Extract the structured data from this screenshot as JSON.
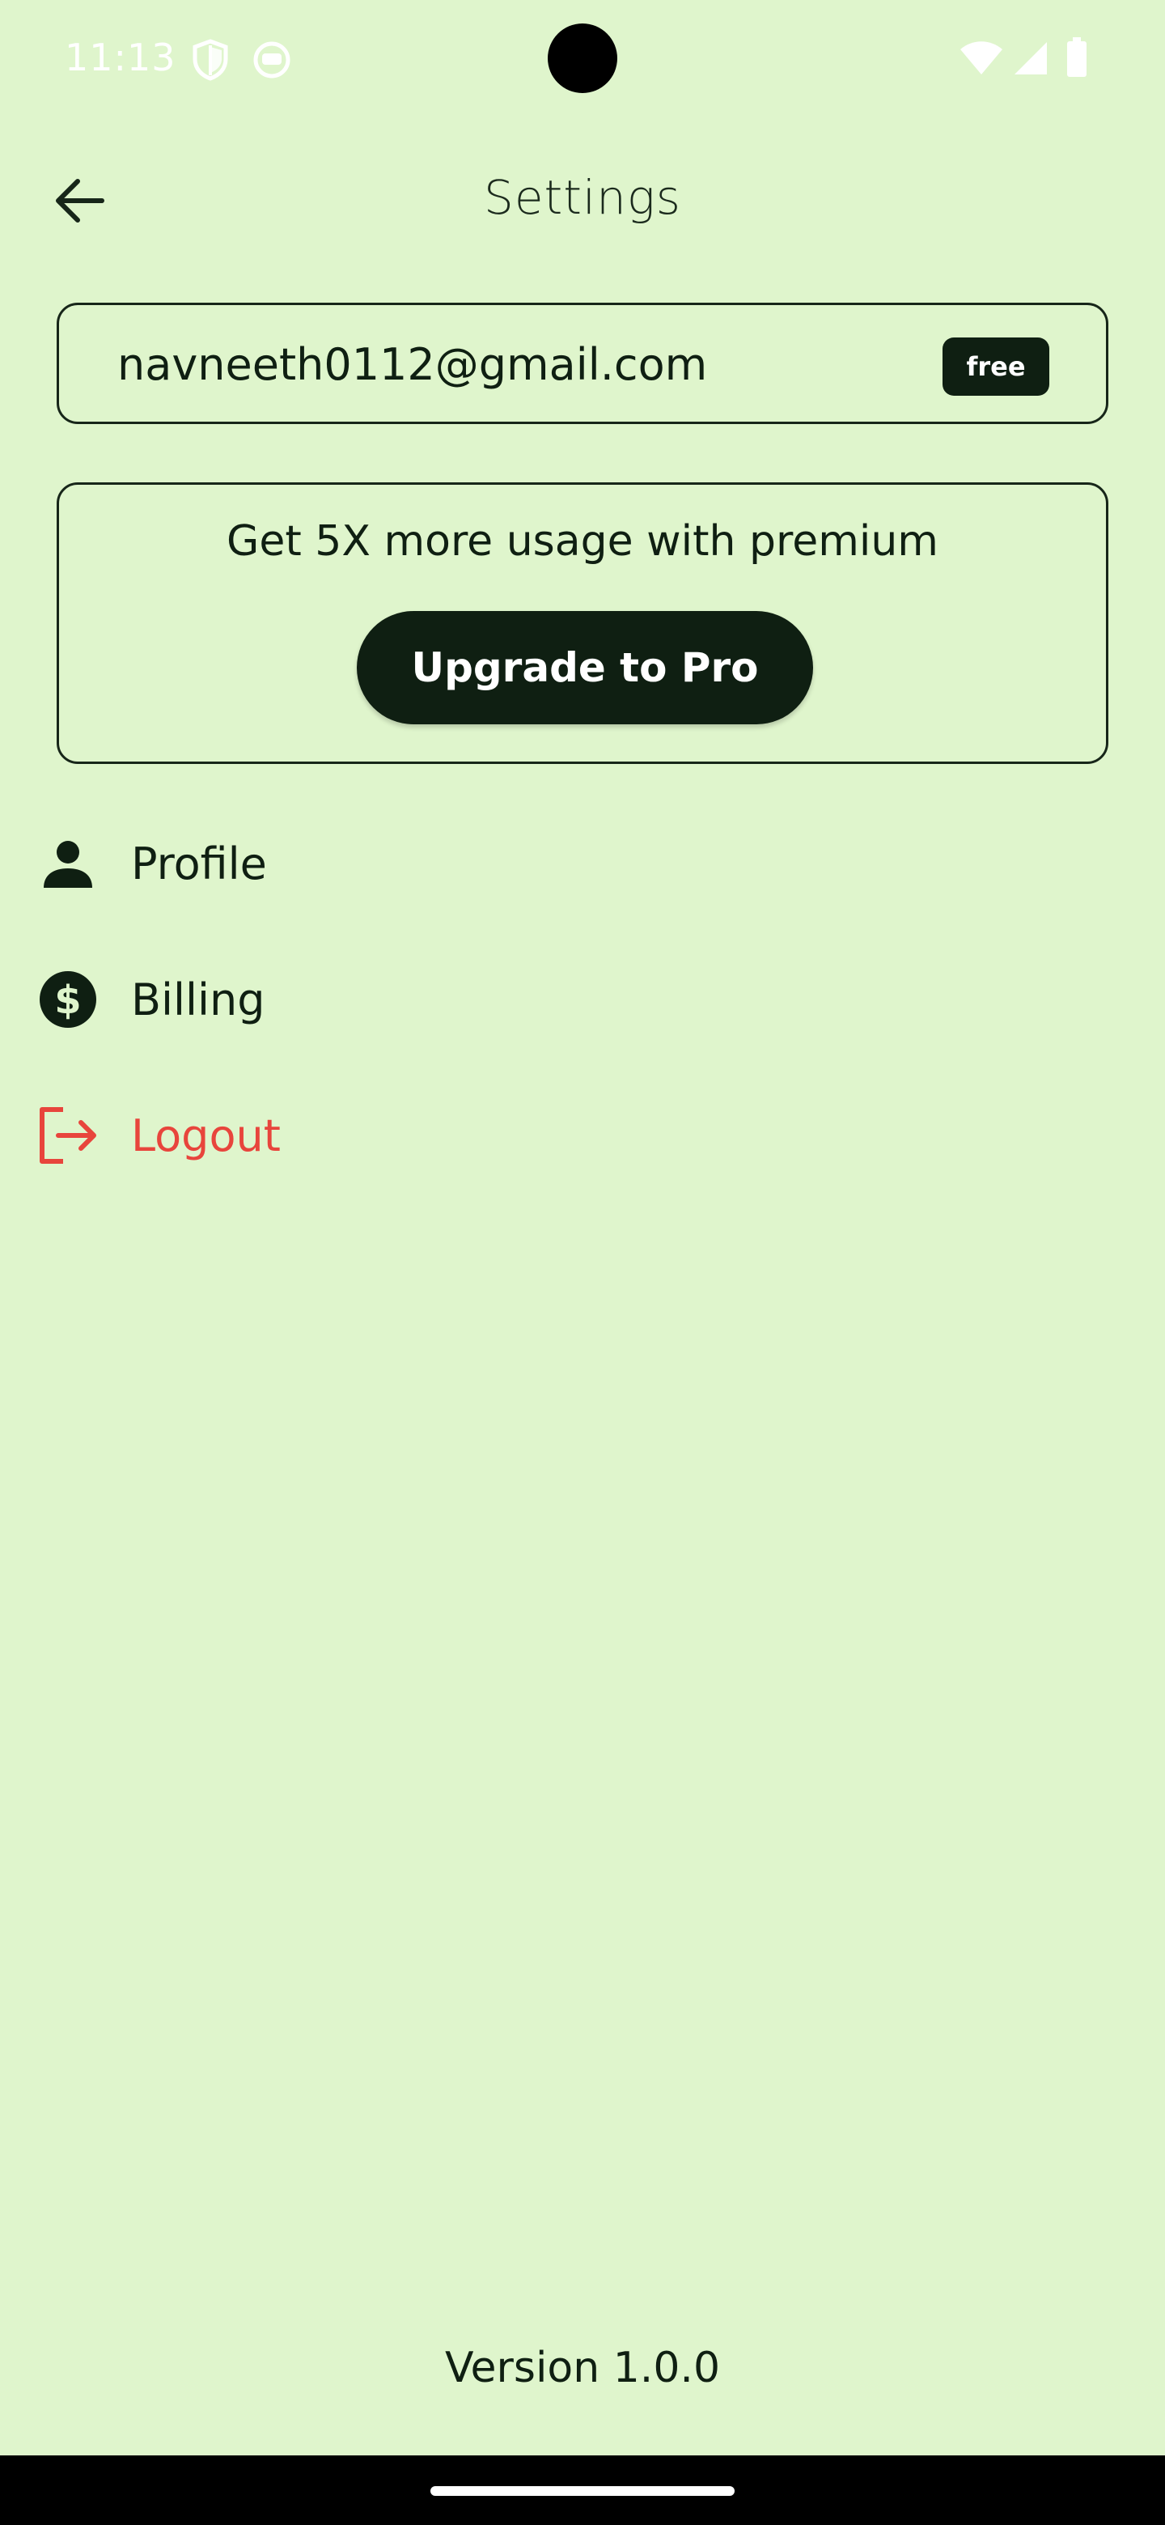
{
  "status_bar": {
    "time": "11:13",
    "icons": [
      "shield-icon",
      "face-icon",
      "wifi-icon",
      "signal-icon",
      "battery-icon"
    ]
  },
  "header": {
    "title": "Settings",
    "back_icon": "arrow-back-icon"
  },
  "account": {
    "email": "navneeth0112@gmail.com",
    "plan_badge": "free"
  },
  "promo": {
    "text": "Get 5X more usage with premium",
    "button_label": "Upgrade to Pro"
  },
  "menu": {
    "items": [
      {
        "label": "Profile",
        "icon": "person-icon"
      },
      {
        "label": "Billing",
        "icon": "dollar-circle-icon"
      },
      {
        "label": "Logout",
        "icon": "logout-icon"
      }
    ]
  },
  "footer": {
    "version": "Version 1.0.0"
  },
  "colors": {
    "background": "#dff5cc",
    "primary_dark": "#0f1f12",
    "logout_red": "#e8453c",
    "on_dark": "#ffffff"
  }
}
